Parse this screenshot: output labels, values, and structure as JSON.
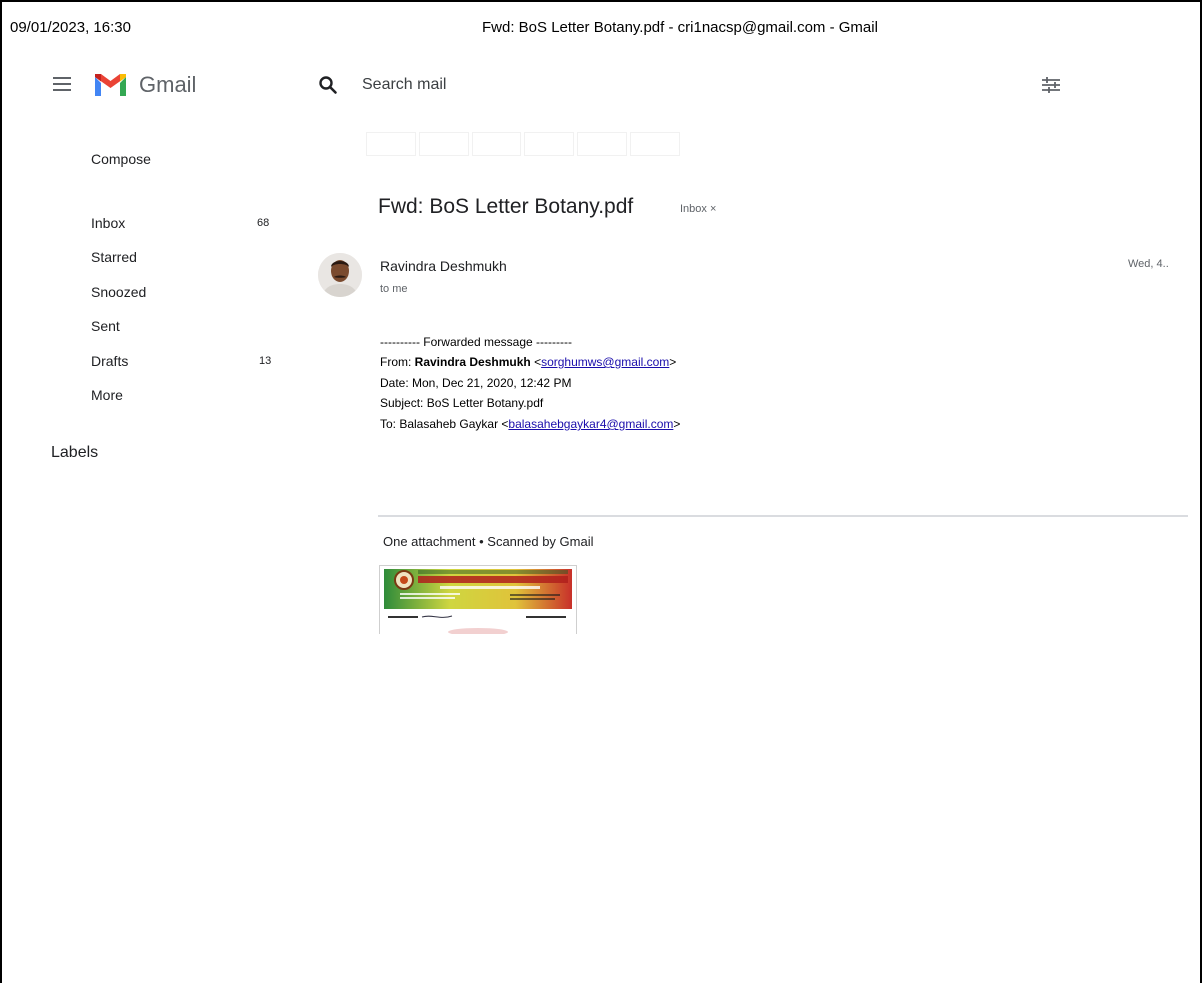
{
  "print_header": {
    "datetime": "09/01/2023, 16:30",
    "title": "Fwd: BoS Letter Botany.pdf - cri1nacsp@gmail.com - Gmail"
  },
  "topbar": {
    "app_name": "Gmail",
    "search_placeholder": "Search mail",
    "icons": [
      "menu-icon",
      "gmail-logo-icon",
      "search-icon",
      "search-options-icon"
    ]
  },
  "sidebar": {
    "compose_label": "Compose",
    "items": [
      {
        "label": "Inbox",
        "count": "68"
      },
      {
        "label": "Starred",
        "count": ""
      },
      {
        "label": "Snoozed",
        "count": ""
      },
      {
        "label": "Sent",
        "count": ""
      },
      {
        "label": "Drafts",
        "count": "13"
      },
      {
        "label": "More",
        "count": ""
      }
    ],
    "labels_heading": "Labels"
  },
  "message": {
    "subject": "Fwd: BoS Letter Botany.pdf",
    "label_chip": "Inbox ×",
    "sender_name": "Ravindra Deshmukh",
    "recipient_line": "to me",
    "date_short": "Wed, 4..",
    "forward_header": "---------- Forwarded message ---------",
    "from_label": "From: ",
    "from_name": "Ravindra Deshmukh",
    "from_email": "sorghumws@gmail.com",
    "date_line": "Date: Mon, Dec 21, 2020, 12:42 PM",
    "subject_line": "Subject: BoS Letter Botany.pdf",
    "to_label": "To: Balasaheb Gaykar ",
    "to_email": "balasahebgaykar4@gmail.com",
    "lt": "<",
    "gt": ">"
  },
  "attachment": {
    "info": "One attachment  • Scanned by Gmail",
    "thumbnail_heading": "New Arts, Commerce & Science College"
  },
  "colors": {
    "link": "#1a0dab",
    "gmail_red": "#ea4335",
    "gmail_blue": "#4285f4",
    "gmail_green": "#34a853",
    "gmail_yellow": "#fbbc04"
  }
}
